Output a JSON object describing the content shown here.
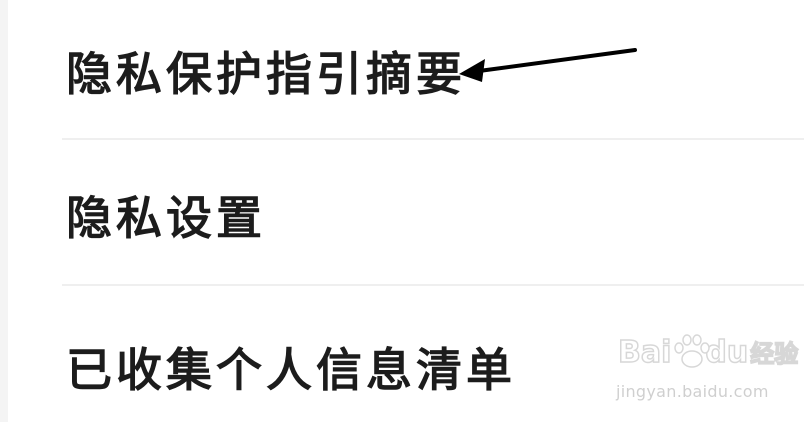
{
  "menu": {
    "items": [
      {
        "label": "隐私保护指引摘要"
      },
      {
        "label": "隐私设置"
      },
      {
        "label": "已收集个人信息清单"
      }
    ]
  },
  "annotation": {
    "arrow_icon": "left-arrow-icon",
    "color": "#000000"
  },
  "watermark": {
    "brand_latin": "Bai",
    "brand_latin_2": "du",
    "brand_cn": "经验",
    "url": "jingyan.baidu.com",
    "icon": "paw-icon"
  }
}
